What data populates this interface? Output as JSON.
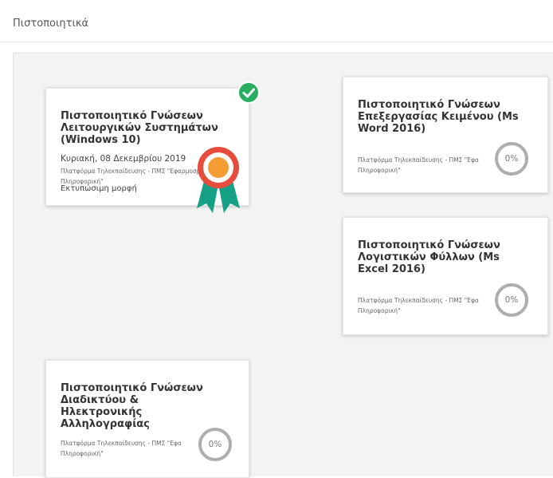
{
  "page": {
    "title": "Πιστοποιητικά"
  },
  "colors": {
    "badge_green": "#27ae60",
    "rosette_red": "#e74c3c",
    "rosette_orange": "#f39c33",
    "ribbon_teal": "#16a085",
    "ring_grey": "#aeaeae"
  },
  "cards": [
    {
      "title": "Πιστοποιητικό Γνώσεων Λειτουργικών Συστημάτων (Windows 10)",
      "completed": true,
      "date": "Κυριακή, 08 Δεκεμβρίου 2019",
      "platform": "Πλατφόρμα Τηλεκπαίδευσης - ΠΜΣ \"Εφαρμοσμένη Πληροφορική\"",
      "print_label": "Εκτυπώσιμη μορφή",
      "icons": [
        "check-circle-icon",
        "award-rosette-icon"
      ]
    },
    {
      "title": "Πιστοποιητικό Γνώσεων Επεξεργασίας Κειμένου (Ms Word 2016)",
      "completed": false,
      "platform": "Πλατφόρμα Τηλεκπαίδευσης - ΠΜΣ \"Εφα",
      "platform_line2": "Πληροφορική\"",
      "progress": "0%"
    },
    {
      "title": "Πιστοποιητικό Γνώσεων Λογιστικών Φύλλων (Ms Excel 2016)",
      "completed": false,
      "platform": "Πλατφόρμα Τηλεκπαίδευσης - ΠΜΣ \"Εφα",
      "platform_line2": "Πληροφορική\"",
      "progress": "0%"
    },
    {
      "title": "Πιστοποιητικό Γνώσεων Διαδικτύου & Ηλεκτρονικής Αλληλογραφίας",
      "completed": false,
      "platform": "Πλατφόρμα Τηλεκπαίδευσης - ΠΜΣ \"Εφα",
      "platform_line2": "Πληροφορική\"",
      "progress": "0%"
    }
  ]
}
